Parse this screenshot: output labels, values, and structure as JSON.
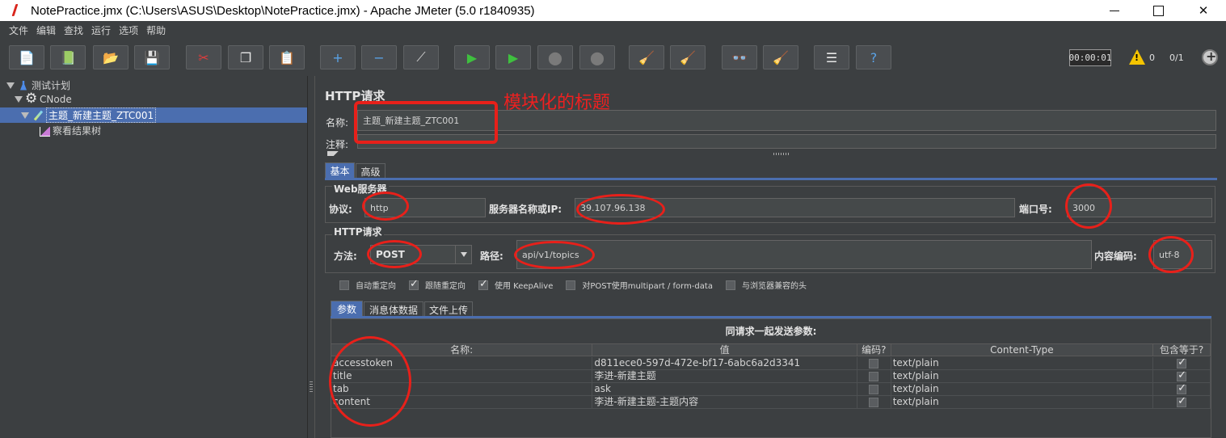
{
  "window": {
    "title": "NotePractice.jmx (C:\\Users\\ASUS\\Desktop\\NotePractice.jmx) - Apache JMeter (5.0 r1840935)"
  },
  "menu": [
    "文件",
    "编辑",
    "查找",
    "运行",
    "选项",
    "帮助"
  ],
  "toolbar": {
    "buttons": [
      {
        "name": "new-icon",
        "glyph": "📄",
        "color": "#f4f4f4"
      },
      {
        "name": "templates-icon",
        "glyph": "📗",
        "color": "#6fbf5a"
      },
      {
        "name": "open-icon",
        "glyph": "📂",
        "color": "#f2c14e"
      },
      {
        "name": "save-icon",
        "glyph": "💾",
        "color": "#c9c9c9"
      },
      {
        "name": "cut-icon",
        "glyph": "✂",
        "color": "#e23c3c"
      },
      {
        "name": "copy-icon",
        "glyph": "❐",
        "color": "#e6e6e6"
      },
      {
        "name": "paste-icon",
        "glyph": "📋",
        "color": "#f2c14e"
      },
      {
        "name": "expand-icon",
        "glyph": "+",
        "color": "#5aa2e6"
      },
      {
        "name": "collapse-icon",
        "glyph": "−",
        "color": "#5aa2e6"
      },
      {
        "name": "toggle-icon",
        "glyph": "⟋",
        "color": "#d4d4d4"
      },
      {
        "name": "start-icon",
        "glyph": "▶",
        "color": "#3fbf3f"
      },
      {
        "name": "start-no-pause-icon",
        "glyph": "▶",
        "color": "#3fbf3f"
      },
      {
        "name": "stop-icon",
        "glyph": "⬤",
        "color": "#7a7a7a"
      },
      {
        "name": "shutdown-icon",
        "glyph": "⬤",
        "color": "#7a7a7a"
      },
      {
        "name": "clear-icon",
        "glyph": "🧹",
        "color": "#d9b36a"
      },
      {
        "name": "clear-all-icon",
        "glyph": "🧹",
        "color": "#d9b36a"
      },
      {
        "name": "search-icon",
        "glyph": "👓",
        "color": "#d4d4d4"
      },
      {
        "name": "reset-search-icon",
        "glyph": "🧹",
        "color": "#f2c14e"
      },
      {
        "name": "function-helper-icon",
        "glyph": "☰",
        "color": "#e6e6e6"
      },
      {
        "name": "help-icon",
        "glyph": "?",
        "color": "#5aa2e6"
      }
    ],
    "timer": "00:00:01",
    "warnings": "0",
    "threads": "0/1"
  },
  "tree": {
    "items": [
      {
        "label": "测试计划",
        "icon": "flask-icon"
      },
      {
        "label": "CNode",
        "icon": "gear-icon"
      },
      {
        "label": "主题_新建主题_ZTC001",
        "icon": "pipette-icon",
        "selected": true
      },
      {
        "label": "察看结果树",
        "icon": "chart-icon"
      }
    ]
  },
  "sampler": {
    "title": "HTTP请求",
    "annotation": "模块化的标题",
    "name_label": "名称:",
    "name_value": "主题_新建主题_ZTC001",
    "comment_label": "注释:",
    "tabs": [
      "基本",
      "高级"
    ],
    "web_server": {
      "legend": "Web服务器",
      "protocol_label": "协议:",
      "protocol_value": "http",
      "server_label": "服务器名称或IP:",
      "server_value": "39.107.96.138",
      "port_label": "端口号:",
      "port_value": "3000"
    },
    "http_request": {
      "legend": "HTTP请求",
      "method_label": "方法:",
      "method_value": "POST",
      "path_label": "路径:",
      "path_value": "api/v1/topics",
      "encoding_label": "内容编码:",
      "encoding_value": "utf-8"
    },
    "options": [
      {
        "label": "自动重定向",
        "checked": false
      },
      {
        "label": "跟随重定向",
        "checked": true
      },
      {
        "label": "使用 KeepAlive",
        "checked": true
      },
      {
        "label": "对POST使用multipart / form-data",
        "checked": false
      },
      {
        "label": "与浏览器兼容的头",
        "checked": false
      }
    ],
    "param_tabs": [
      "参数",
      "消息体数据",
      "文件上传"
    ],
    "table": {
      "caption": "同请求一起发送参数:",
      "columns": [
        "名称:",
        "值",
        "编码?",
        "Content-Type",
        "包含等于?"
      ],
      "rows": [
        {
          "name": "accesstoken",
          "value": "d811ece0-597d-472e-bf17-6abc6a2d3341",
          "encode": false,
          "content_type": "text/plain",
          "include_equals": true
        },
        {
          "name": "title",
          "value": "李进-新建主题",
          "encode": false,
          "content_type": "text/plain",
          "include_equals": true
        },
        {
          "name": "tab",
          "value": "ask",
          "encode": false,
          "content_type": "text/plain",
          "include_equals": true
        },
        {
          "name": "content",
          "value": "李进-新建主题-主题内容",
          "encode": false,
          "content_type": "text/plain",
          "include_equals": true
        }
      ]
    }
  }
}
